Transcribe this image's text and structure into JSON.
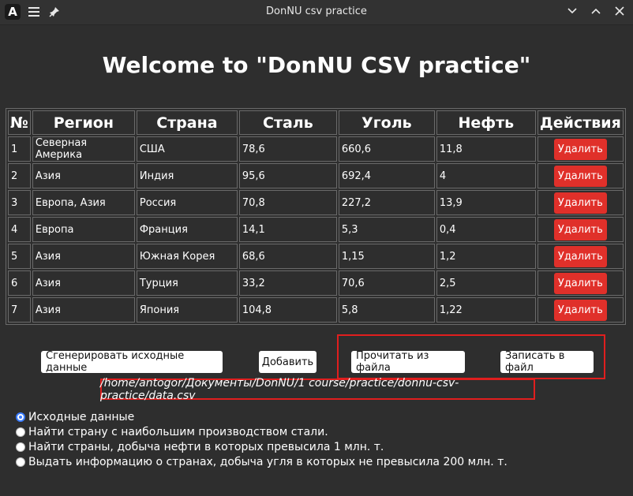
{
  "window": {
    "title": "DonNU csv practice",
    "logo": "A"
  },
  "heading": "Welcome to \"DonNU CSV practice\"",
  "table": {
    "headers": [
      "№",
      "Регион",
      "Страна",
      "Сталь",
      "Уголь",
      "Нефть",
      "Действия"
    ],
    "rows": [
      [
        "1",
        "Северная Америка",
        "США",
        "78,6",
        "660,6",
        "11,8"
      ],
      [
        "2",
        "Азия",
        "Индия",
        "95,6",
        "692,4",
        "4"
      ],
      [
        "3",
        "Европа, Азия",
        "Россия",
        "70,8",
        "227,2",
        "13,9"
      ],
      [
        "4",
        "Европа",
        "Франция",
        "14,1",
        "5,3",
        "0,4"
      ],
      [
        "5",
        "Азия",
        "Южная Корея",
        "68,6",
        "1,15",
        "1,2"
      ],
      [
        "6",
        "Азия",
        "Турция",
        "33,2",
        "70,6",
        "2,5"
      ],
      [
        "7",
        "Азия",
        "Япония",
        "104,8",
        "5,8",
        "1,22"
      ]
    ],
    "delete_label": "Удалить"
  },
  "buttons": {
    "generate": "Сгенерировать исходные данные",
    "add": "Добавить",
    "read": "Прочитать из файла",
    "write": "Записать в файл"
  },
  "file_path": "/home/antogor/Документы/DonNU/1 course/practice/donnu-csv-practice/data.csv",
  "radios": [
    {
      "label": "Исходные данные",
      "checked": true
    },
    {
      "label": "Найти страну с наибольшим производством стали.",
      "checked": false
    },
    {
      "label": "Найти страны, добыча нефти в которых превысила 1 млн. т.",
      "checked": false
    },
    {
      "label": "Выдать информацию о странах, добыча угля в которых не превысила 200 млн. т.",
      "checked": false
    }
  ],
  "colors": {
    "background": "#2e2e2e",
    "delete_button": "#e0302a",
    "highlight_box": "#e01e1e",
    "radio_accent": "#3a7cff"
  }
}
